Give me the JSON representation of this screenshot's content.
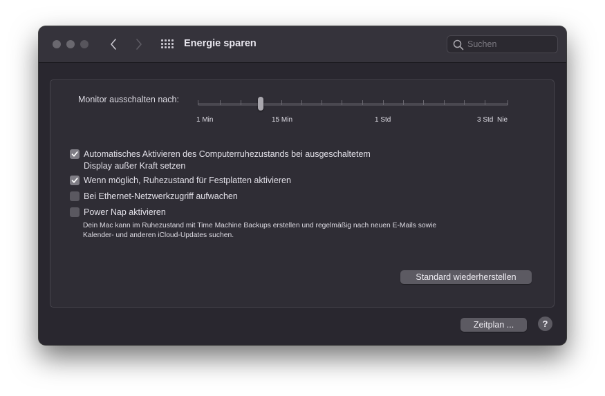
{
  "window": {
    "title": "Energie sparen"
  },
  "search": {
    "placeholder": "Suchen"
  },
  "slider": {
    "label": "Monitor ausschalten nach:",
    "value": "10 Min",
    "ticks": {
      "t1": "1 Min",
      "t2": "15 Min",
      "t3": "1 Std",
      "t4": "3 Std",
      "t5": "Nie"
    }
  },
  "options": [
    {
      "label_line1": "Automatisches Aktivieren des Computerruhezustands bei ausgeschaltetem",
      "label_line2": "Display außer Kraft setzen",
      "checked": true
    },
    {
      "label": "Wenn möglich, Ruhezustand für Festplatten aktivieren",
      "checked": true
    },
    {
      "label": "Bei Ethernet-Netzwerkzugriff aufwachen",
      "checked": false
    },
    {
      "label": "Power Nap aktivieren",
      "checked": false
    }
  ],
  "power_nap_description": {
    "line1": "Dein Mac kann im Ruhezustand mit Time Machine Backups erstellen und regelmäßig nach neuen E-Mails sowie",
    "line2": "Kalender- und anderen iCloud-Updates suchen."
  },
  "buttons": {
    "restore": "Standard wiederherstellen",
    "schedule": "Zeitplan ...",
    "help": "?"
  },
  "icons": {
    "back": "chevron-left-icon",
    "forward": "chevron-right-icon",
    "grid": "grid-icon",
    "search": "search-icon",
    "checkmark": "checkmark-icon"
  }
}
